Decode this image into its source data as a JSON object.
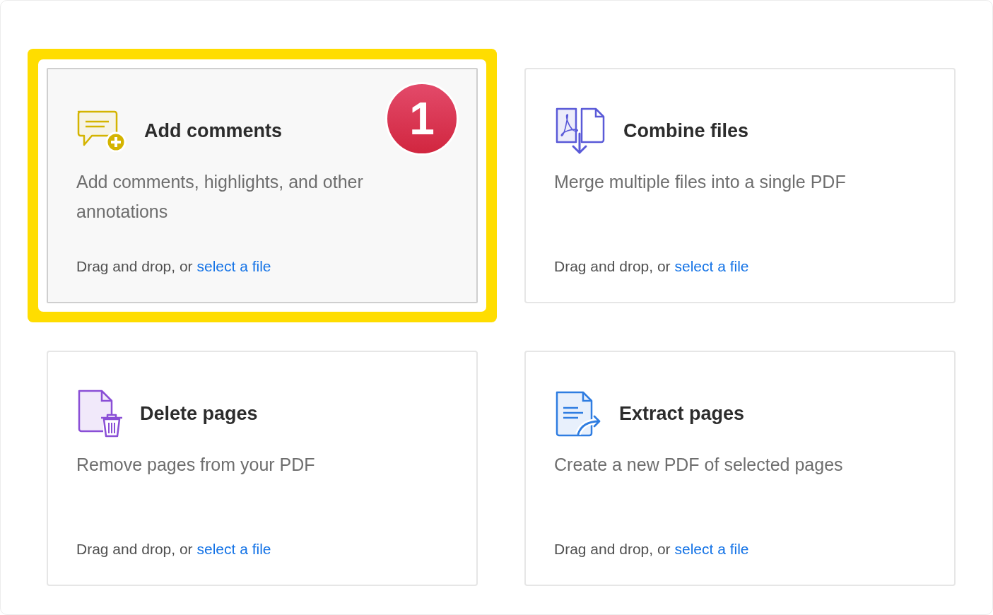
{
  "cards": [
    {
      "kind": "comment",
      "title": "Add comments",
      "description": "Add comments, highlights, and other annotations",
      "prompt": "Drag and drop, or",
      "link": "select a file",
      "highlighted": true,
      "badge": "1"
    },
    {
      "kind": "combine",
      "title": "Combine files",
      "description": "Merge multiple files into a single PDF",
      "prompt": "Drag and drop, or",
      "link": "select a file",
      "highlighted": false
    },
    {
      "kind": "delete",
      "title": "Delete pages",
      "description": "Remove pages from your PDF",
      "prompt": "Drag and drop, or",
      "link": "select a file",
      "highlighted": false
    },
    {
      "kind": "extract",
      "title": "Extract pages",
      "description": "Create a new PDF of selected pages",
      "prompt": "Drag and drop, or",
      "link": "select a file",
      "highlighted": false
    }
  ]
}
